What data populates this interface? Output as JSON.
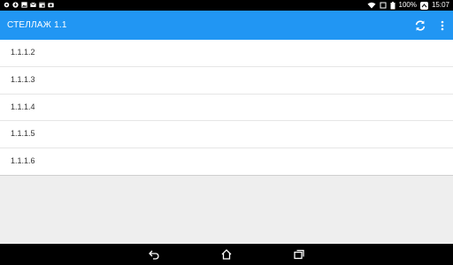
{
  "status_bar": {
    "battery": "100%",
    "time": "15:07",
    "left_icons": [
      "settings-icon",
      "download-icon",
      "gallery-icon",
      "mail-icon",
      "calendar-icon",
      "camera-icon"
    ]
  },
  "app_bar": {
    "title": "СТЕЛЛАЖ 1.1",
    "actions": [
      "refresh-icon",
      "overflow-menu-icon"
    ]
  },
  "list": {
    "items": [
      {
        "label": "1.1.1.2"
      },
      {
        "label": "1.1.1.3"
      },
      {
        "label": "1.1.1.4"
      },
      {
        "label": "1.1.1.5"
      },
      {
        "label": "1.1.1.6"
      }
    ]
  },
  "nav_bar": {
    "buttons": [
      "back-icon",
      "home-icon",
      "recents-icon"
    ]
  },
  "colors": {
    "primary": "#2196f3",
    "background": "#eeeeee",
    "status_bar": "#000000"
  }
}
